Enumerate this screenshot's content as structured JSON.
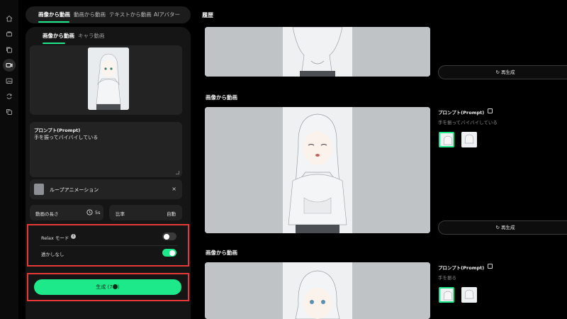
{
  "nav": {
    "tabs": [
      {
        "label": "画像から動画",
        "active": true
      },
      {
        "label": "動画から動画",
        "active": false
      },
      {
        "label": "テキストから動画",
        "active": false
      },
      {
        "label": "AIアバター",
        "active": false
      }
    ],
    "rail_icons": [
      "home-icon",
      "cube-icon",
      "layers-icon",
      "video-icon",
      "image-icon",
      "sync-icon",
      "copy-icon"
    ]
  },
  "panel": {
    "sub_tabs": [
      {
        "label": "画像から動画",
        "active": true
      },
      {
        "label": "キャラ動画",
        "active": false
      }
    ],
    "prompt_label": "プロンプト(Prompt)",
    "prompt_value": "手を振ってバイバイしている",
    "loop_label": "ループアニメーション",
    "loop_close": "×",
    "duration_label": "動画の長さ",
    "duration_value": "5s",
    "ratio_label": "比率",
    "ratio_value": "自動",
    "relax_label": "Relax モード",
    "relax_on": false,
    "watermark_label": "透かしなし",
    "watermark_on": true,
    "generate_label": "生成 (7",
    "generate_suffix": ")"
  },
  "history": {
    "title": "履歴",
    "regen_label": "再生成",
    "items": [
      {
        "section_title": "",
        "prompt_label": "",
        "prompt_text": ""
      },
      {
        "section_title": "画像から動画",
        "prompt_label": "プロンプト(Prompt)",
        "prompt_text": "手を振ってバイバイしている"
      },
      {
        "section_title": "画像から動画",
        "prompt_label": "プロンプト(Prompt)",
        "prompt_text": "手を振る"
      }
    ]
  },
  "colors": {
    "accent": "#1de98b",
    "highlight": "#e53935",
    "panel": "#151515",
    "card": "#232323"
  }
}
